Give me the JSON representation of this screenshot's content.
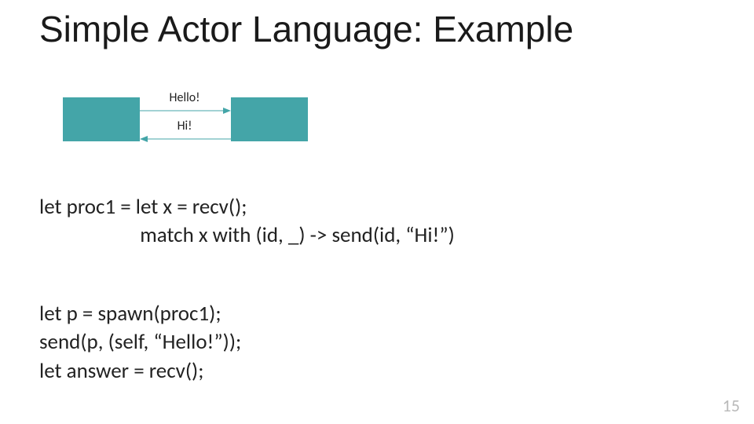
{
  "title": "Simple Actor Language: Example",
  "diagram": {
    "msg_top": "Hello!",
    "msg_bottom": "Hi!",
    "box_color": "#44a5a8"
  },
  "code1": {
    "line1": "let proc1 = let x = recv();",
    "line2_indent": "                     ",
    "line2": "match x with (id, _) -> send(id, “Hi!”)"
  },
  "code2": {
    "line1": "let p = spawn(proc1);",
    "line2": "send(p, (self, “Hello!”));",
    "line3": "let answer = recv();"
  },
  "page_number": "15"
}
